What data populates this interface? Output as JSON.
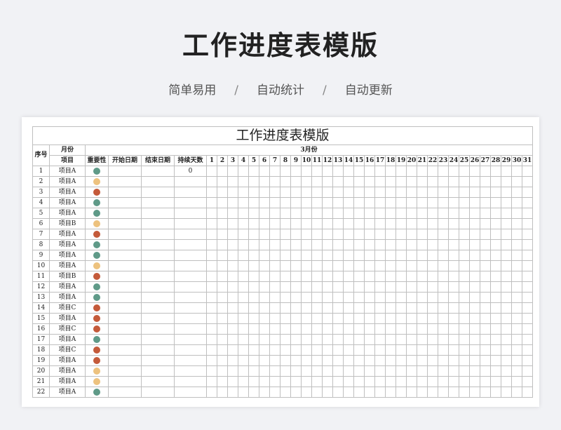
{
  "hero": {
    "title": "工作进度表模版",
    "subtitle_items": [
      "简单易用",
      "自动统计",
      "自动更新"
    ],
    "separator": "/"
  },
  "sheet": {
    "title": "工作进度表模版",
    "headers": {
      "seq": "序号",
      "month": "月份",
      "project": "项目",
      "importance": "重要性",
      "start_date": "开始日期",
      "end_date": "结束日期",
      "duration": "持续天数",
      "month_label": "3月份"
    },
    "days": [
      "1",
      "2",
      "3",
      "4",
      "5",
      "6",
      "7",
      "8",
      "9",
      "10",
      "11",
      "12",
      "13",
      "14",
      "15",
      "16",
      "17",
      "18",
      "19",
      "20",
      "21",
      "22",
      "23",
      "24",
      "25",
      "26",
      "27",
      "28",
      "29",
      "30",
      "31"
    ],
    "importance_colors": {
      "green": "#5f9a88",
      "orange": "#edc27e",
      "red": "#c45a3a"
    },
    "rows": [
      {
        "seq": "1",
        "project": "项目A",
        "importance": "green",
        "duration": "0"
      },
      {
        "seq": "2",
        "project": "项目A",
        "importance": "orange",
        "duration": ""
      },
      {
        "seq": "3",
        "project": "项目A",
        "importance": "red",
        "duration": ""
      },
      {
        "seq": "4",
        "project": "项目A",
        "importance": "green",
        "duration": ""
      },
      {
        "seq": "5",
        "project": "项目A",
        "importance": "green",
        "duration": ""
      },
      {
        "seq": "6",
        "project": "项目B",
        "importance": "orange",
        "duration": ""
      },
      {
        "seq": "7",
        "project": "项目A",
        "importance": "red",
        "duration": ""
      },
      {
        "seq": "8",
        "project": "项目A",
        "importance": "green",
        "duration": ""
      },
      {
        "seq": "9",
        "project": "项目A",
        "importance": "green",
        "duration": ""
      },
      {
        "seq": "10",
        "project": "项目A",
        "importance": "orange",
        "duration": ""
      },
      {
        "seq": "11",
        "project": "项目B",
        "importance": "red",
        "duration": ""
      },
      {
        "seq": "12",
        "project": "项目A",
        "importance": "green",
        "duration": ""
      },
      {
        "seq": "13",
        "project": "项目A",
        "importance": "green",
        "duration": ""
      },
      {
        "seq": "14",
        "project": "项目C",
        "importance": "red",
        "duration": ""
      },
      {
        "seq": "15",
        "project": "项目A",
        "importance": "red",
        "duration": ""
      },
      {
        "seq": "16",
        "project": "项目C",
        "importance": "red",
        "duration": ""
      },
      {
        "seq": "17",
        "project": "项目A",
        "importance": "green",
        "duration": ""
      },
      {
        "seq": "18",
        "project": "项目C",
        "importance": "red",
        "duration": ""
      },
      {
        "seq": "19",
        "project": "项目A",
        "importance": "red",
        "duration": ""
      },
      {
        "seq": "20",
        "project": "项目A",
        "importance": "orange",
        "duration": ""
      },
      {
        "seq": "21",
        "project": "项目A",
        "importance": "orange",
        "duration": ""
      },
      {
        "seq": "22",
        "project": "项目A",
        "importance": "green",
        "duration": ""
      }
    ]
  }
}
